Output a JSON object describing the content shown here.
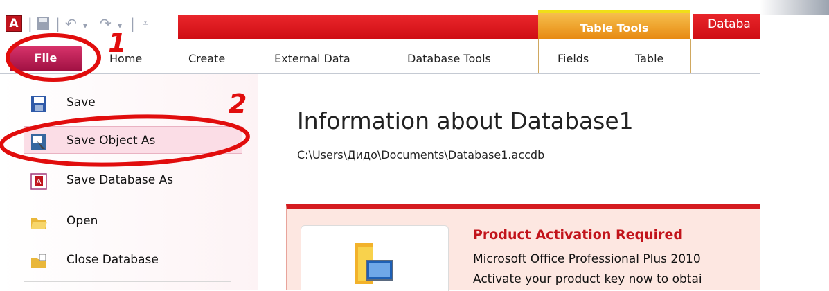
{
  "title_bar": {
    "app_logo": "A",
    "context_group": "Table Tools",
    "window_title": "Databa"
  },
  "tabs": [
    {
      "label": "File"
    },
    {
      "label": "Home"
    },
    {
      "label": "Create"
    },
    {
      "label": "External Data"
    },
    {
      "label": "Database Tools"
    },
    {
      "label": "Fields"
    },
    {
      "label": "Table"
    }
  ],
  "backstage_menu": [
    {
      "label": "Save",
      "icon": "save-icon"
    },
    {
      "label": "Save Object As",
      "icon": "save-object-as-icon"
    },
    {
      "label": "Save Database As",
      "icon": "save-database-as-icon"
    },
    {
      "label": "Open",
      "icon": "open-folder-icon"
    },
    {
      "label": "Close Database",
      "icon": "close-database-icon"
    }
  ],
  "info": {
    "title": "Information about Database1",
    "path": "C:\\Users\\Дидо\\Documents\\Database1.accdb"
  },
  "activation": {
    "title": "Product Activation Required",
    "line1": "Microsoft Office Professional Plus 2010",
    "line2": "Activate your product key now to obtai"
  },
  "annotations": {
    "step1": "1",
    "step2": "2"
  },
  "colors": {
    "file_tab": "#b8164f",
    "title_red": "#d71920",
    "table_tools": "#eea12b",
    "annotation_red": "#e10d0d"
  }
}
